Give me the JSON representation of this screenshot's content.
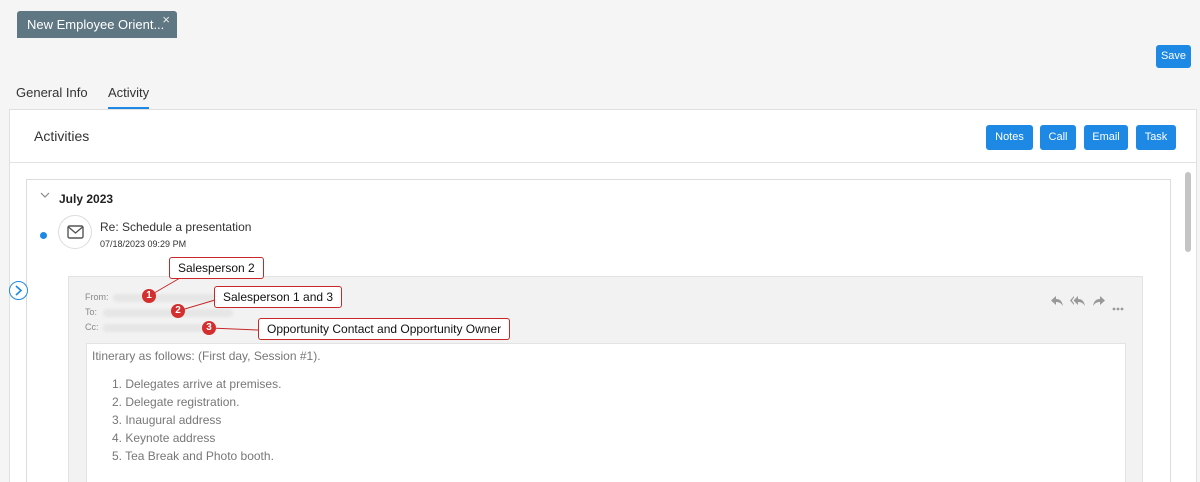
{
  "document_tab": {
    "label": "New Employee Orient...",
    "close": "×"
  },
  "save_button": "Save",
  "tabs": [
    {
      "label": "General Info"
    },
    {
      "label": "Activity"
    }
  ],
  "panel": {
    "title": "Activities",
    "buttons": [
      "Notes",
      "Call",
      "Email",
      "Task"
    ]
  },
  "month": "July 2023",
  "activity": {
    "subject": "Re: Schedule a presentation",
    "datetime": "07/18/2023 09:29 PM"
  },
  "email": {
    "from_label": "From:",
    "to_label": "To:",
    "cc_label": "Cc:",
    "intro": "Itinerary as follows: (First day, Session #1).",
    "items": [
      "1. Delegates arrive at premises.",
      "2. Delegate registration.",
      "3. Inaugural address",
      "4. Keynote address",
      "5. Tea Break and Photo booth."
    ]
  },
  "callouts": [
    {
      "badge": "1",
      "text": "Salesperson 2"
    },
    {
      "badge": "2",
      "text": "Salesperson 1 and 3"
    },
    {
      "badge": "3",
      "text": "Opportunity Contact and Opportunity Owner"
    }
  ],
  "colors": {
    "accent": "#1e88e5",
    "tab_bg": "#5f7683",
    "callout_red": "#d32f2f"
  }
}
